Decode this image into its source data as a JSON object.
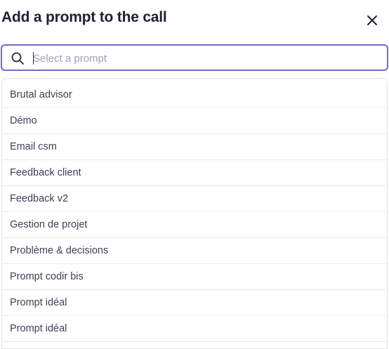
{
  "dialog": {
    "title": "Add a prompt to the call",
    "close_icon": "close-icon"
  },
  "search": {
    "placeholder": "Select a prompt",
    "value": "",
    "icon": "search-icon"
  },
  "options": [
    {
      "label": "Brutal advisor"
    },
    {
      "label": "Démo"
    },
    {
      "label": "Email csm"
    },
    {
      "label": "Feedback client"
    },
    {
      "label": "Feedback v2"
    },
    {
      "label": "Gestion de projet"
    },
    {
      "label": "Problème & decisions"
    },
    {
      "label": "Prompt codir bis"
    },
    {
      "label": "Prompt idéal"
    },
    {
      "label": "Prompt idéal"
    }
  ],
  "colors": {
    "accent_border": "#7868c9",
    "title": "#1d2033",
    "option_text": "#3c4254",
    "divider": "#e7e9ee"
  }
}
